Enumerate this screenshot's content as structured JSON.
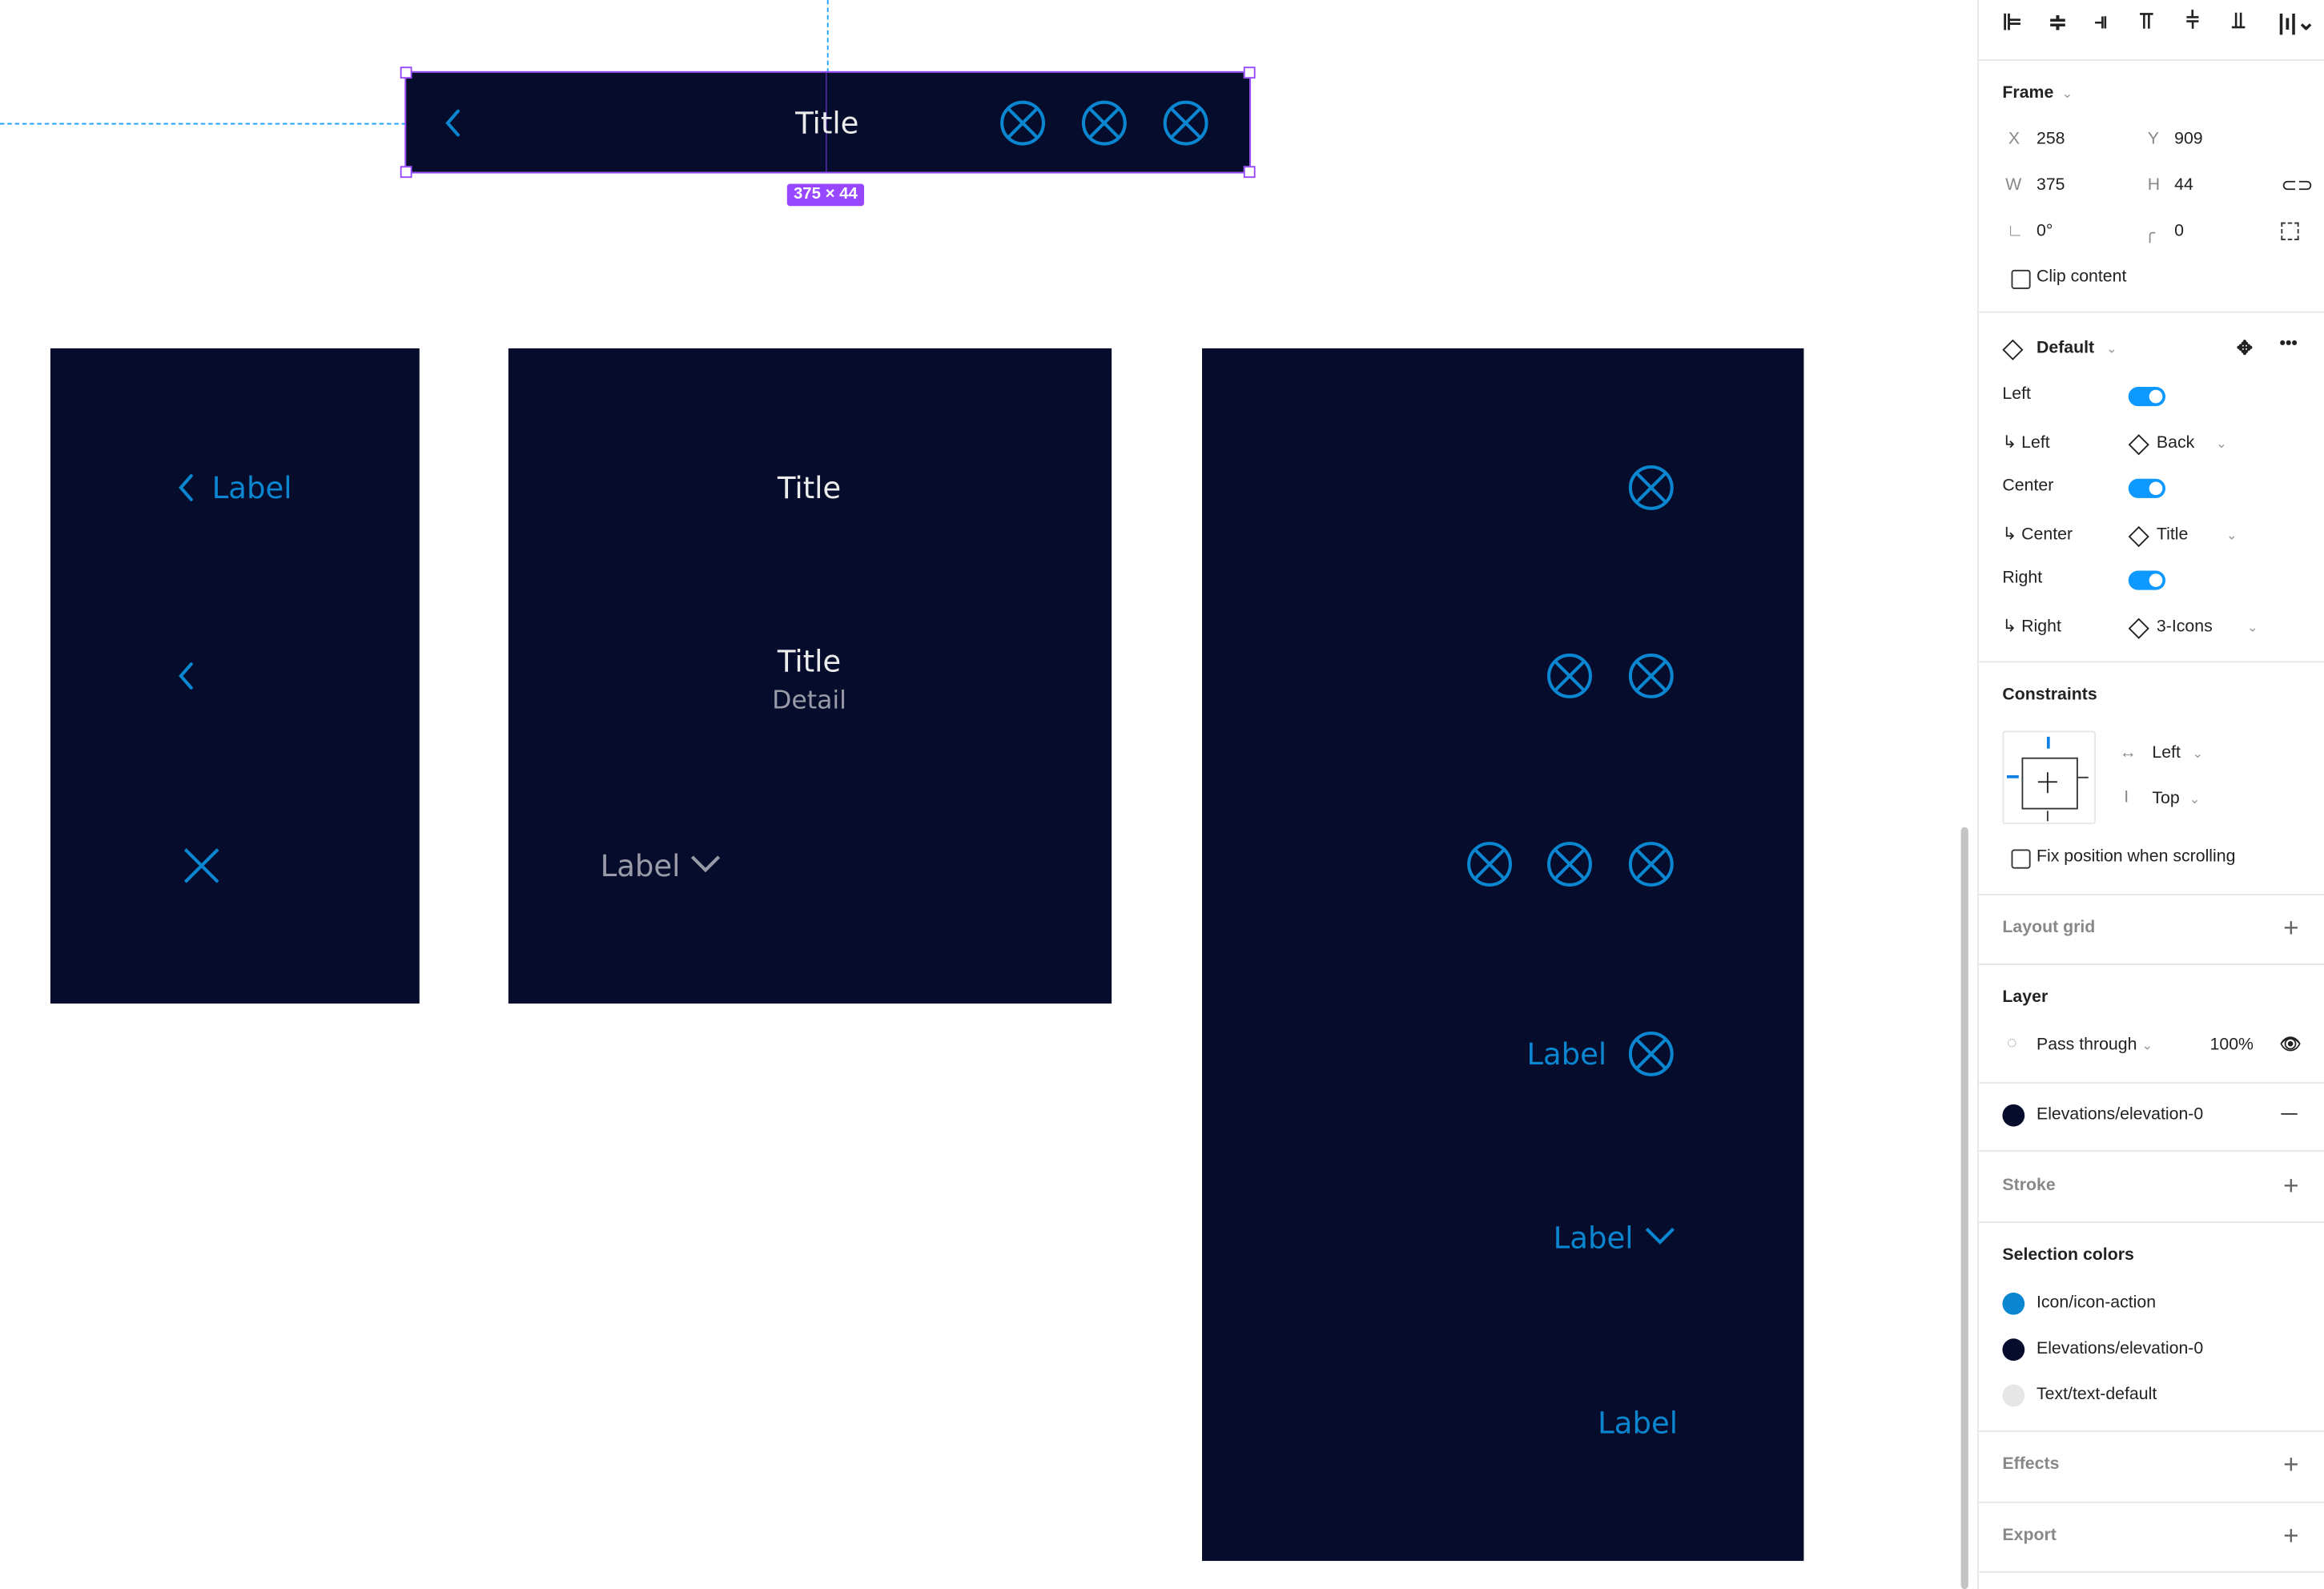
{
  "canvas": {
    "selected_bar": {
      "title": "Title",
      "size_badge": "375 × 44"
    },
    "left_panel": {
      "back_label": "Label"
    },
    "center_panel": {
      "title": "Title",
      "title2": "Title",
      "detail": "Detail",
      "dropdown_label": "Label"
    },
    "right_panel": {
      "label_icon": "Label",
      "label_dropdown": "Label",
      "label_only": "Label"
    }
  },
  "colors": {
    "background": "#050c2c",
    "action": "#0a87d0",
    "text": "#ececec",
    "selection": "#9747ff"
  },
  "inspector": {
    "align_icons": [
      "align-left-icon",
      "align-horizontal-center-icon",
      "align-right-icon",
      "align-top-icon",
      "align-vertical-center-icon",
      "align-bottom-icon",
      "distribute-icon"
    ],
    "frame": {
      "title": "Frame",
      "x_label": "X",
      "x": "258",
      "y_label": "Y",
      "y": "909",
      "w_label": "W",
      "w": "375",
      "h_label": "H",
      "h": "44",
      "rotation": "0°",
      "radius": "0",
      "clip_content": "Clip content"
    },
    "component": {
      "variant": "Default",
      "props": [
        {
          "label": "Left",
          "type": "toggle",
          "on": true
        },
        {
          "label": "↳ Left",
          "type": "instance",
          "value": "Back"
        },
        {
          "label": "Center",
          "type": "toggle",
          "on": true
        },
        {
          "label": "↳ Center",
          "type": "instance",
          "value": "Title"
        },
        {
          "label": "Right",
          "type": "toggle",
          "on": true
        },
        {
          "label": "↳ Right",
          "type": "instance",
          "value": "3-Icons"
        }
      ]
    },
    "constraints": {
      "title": "Constraints",
      "horizontal": "Left",
      "vertical": "Top",
      "fix_position": "Fix position when scrolling"
    },
    "layout_grid": "Layout grid",
    "layer": {
      "title": "Layer",
      "blend": "Pass through",
      "opacity": "100%",
      "fill": "Elevations/elevation-0"
    },
    "stroke": "Stroke",
    "selection_colors": {
      "title": "Selection colors",
      "items": [
        {
          "name": "Icon/icon-action",
          "color": "#0a87d0"
        },
        {
          "name": "Elevations/elevation-0",
          "color": "#050c2c"
        },
        {
          "name": "Text/text-default",
          "color": "#e6e6e6"
        }
      ]
    },
    "effects": "Effects",
    "export": "Export"
  }
}
